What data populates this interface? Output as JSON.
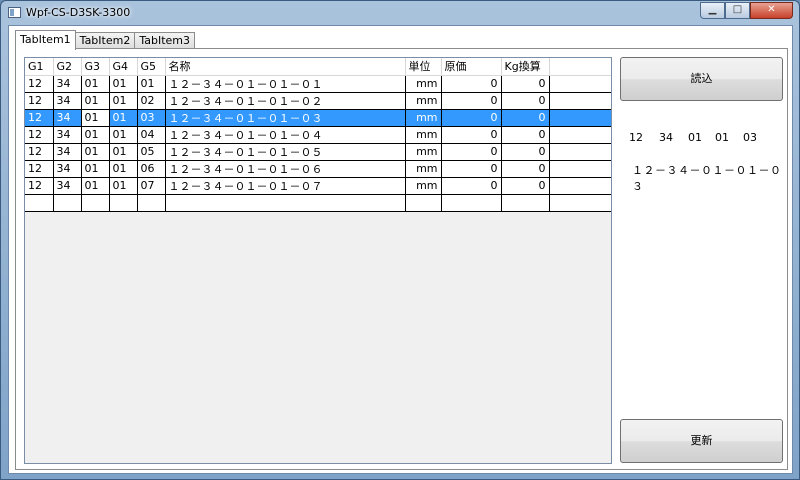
{
  "window": {
    "title": "Wpf-CS-D3SK-3300",
    "min_glyph": "▁",
    "max_glyph": "□",
    "close_glyph": "✕"
  },
  "tabs": [
    {
      "label": "TabItem1",
      "active": true
    },
    {
      "label": "TabItem2",
      "active": false
    },
    {
      "label": "TabItem3",
      "active": false
    }
  ],
  "grid": {
    "columns": [
      "G1",
      "G2",
      "G3",
      "G4",
      "G5",
      "名称",
      "単位",
      "原価",
      "Kg換算"
    ],
    "rows": [
      [
        "12",
        "34",
        "01",
        "01",
        "01",
        "１２－３４－０１－０１－０１",
        "mm",
        "0",
        "0"
      ],
      [
        "12",
        "34",
        "01",
        "01",
        "02",
        "１２－３４－０１－０１－０２",
        "mm",
        "0",
        "0"
      ],
      [
        "12",
        "34",
        "01",
        "01",
        "03",
        "１２－３４－０１－０１－０３",
        "mm",
        "0",
        "0"
      ],
      [
        "12",
        "34",
        "01",
        "01",
        "04",
        "１２－３４－０１－０１－０４",
        "mm",
        "0",
        "0"
      ],
      [
        "12",
        "34",
        "01",
        "01",
        "05",
        "１２－３４－０１－０１－０５",
        "mm",
        "0",
        "0"
      ],
      [
        "12",
        "34",
        "01",
        "01",
        "06",
        "１２－３４－０１－０１－０６",
        "mm",
        "0",
        "0"
      ],
      [
        "12",
        "34",
        "01",
        "01",
        "07",
        "１２－３４－０１－０１－０７",
        "mm",
        "0",
        "0"
      ]
    ],
    "selected_row": 2
  },
  "side": {
    "read_button": "読込",
    "update_button": "更新",
    "detail_codes": [
      "12",
      "34",
      "01",
      "01",
      "03"
    ],
    "detail_name": "１２－３４－０１－０１－０３"
  }
}
